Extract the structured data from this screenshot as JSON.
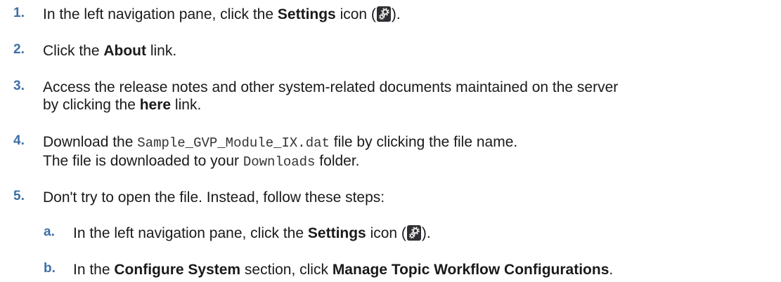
{
  "steps": [
    {
      "number": "1.",
      "parts": [
        "In the left navigation pane, click the ",
        "Settings",
        " icon (",
        ")."
      ],
      "icon": "settings-gear-icon"
    },
    {
      "number": "2.",
      "parts": [
        "Click the ",
        "About",
        " link."
      ]
    },
    {
      "number": "3.",
      "line1": "Access the release notes and other system-related documents maintained on the server",
      "line2_parts": [
        "by clicking the ",
        "here",
        " link."
      ]
    },
    {
      "number": "4.",
      "line1_parts": [
        "Download the ",
        "Sample_GVP_Module_IX.dat",
        " file by clicking the file name."
      ],
      "line2_parts": [
        "The file is downloaded to your ",
        "Downloads",
        " folder."
      ]
    },
    {
      "number": "5.",
      "text": "Don't try to open the file. Instead, follow these steps:"
    }
  ],
  "substeps": [
    {
      "letter": "a.",
      "parts": [
        "In the left navigation pane, click the ",
        "Settings",
        " icon (",
        ")."
      ],
      "icon": "settings-gear-icon"
    },
    {
      "letter": "b.",
      "parts": [
        "In the ",
        "Configure System",
        " section, click ",
        "Manage Topic Workflow Configurations",
        "."
      ]
    }
  ]
}
